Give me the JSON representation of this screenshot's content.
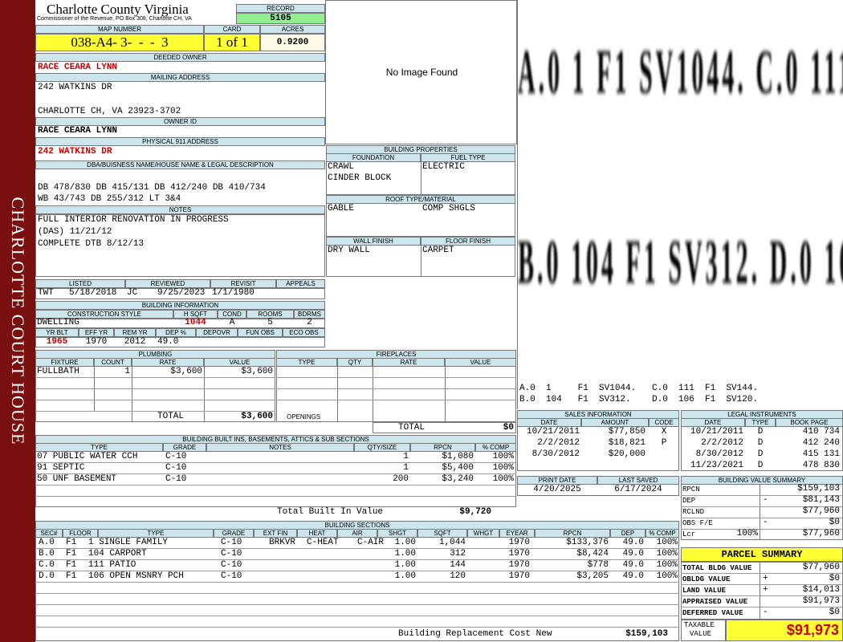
{
  "side_title": "CHARLOTTE COURT HOUSE",
  "county": {
    "title": "Charlotte County Virginia",
    "subtitle": "Commissioner of the Revenue, PO Box 308, Charlotte CH, VA"
  },
  "record": {
    "label": "RECORD",
    "value": "5105"
  },
  "map": {
    "label": "MAP NUMBER",
    "value": "038-A4- 3-  -  -  3"
  },
  "card": {
    "label": "CARD",
    "value": "1 of 1"
  },
  "acres": {
    "label": "ACRES",
    "value": "0.9200"
  },
  "deeded_owner": {
    "label": "DEEDED OWNER",
    "value": "RACE CEARA LYNN"
  },
  "mailing": {
    "label": "MAILING ADDRESS",
    "line1": "242 WATKINS DR",
    "line2": "CHARLOTTE CH, VA 23923-3702"
  },
  "owner_id": {
    "label": "OWNER ID",
    "value": "RACE CEARA LYNN"
  },
  "physical": {
    "label": "PHYSICAL 911 ADDRESS",
    "value": "242 WATKINS DR"
  },
  "legal": {
    "label": "DBA/BUISNESS NAME/HOUSE NAME & LEGAL DESCRIPTION",
    "line1": "DB 478/830 DB 415/131 DB 412/240 DB 410/734",
    "line2": "WB 43/743 DB 255/312 LT 3&4"
  },
  "notes": {
    "label": "NOTES",
    "line1": "FULL INTERIOR RENOVATION IN PROGRESS",
    "line2": "(DAS) 11/21/12",
    "line3": "COMPLETE DTB 8/12/13"
  },
  "listed": {
    "label": "LISTED",
    "by": "TWT",
    "date": "5/18/2018"
  },
  "reviewed": {
    "label": "REVIEWED",
    "by": "JC",
    "date": "9/25/2023"
  },
  "revisit": {
    "label": "REVISIT",
    "date": "1/1/1980"
  },
  "appeals": {
    "label": "APPEALS"
  },
  "building_info": {
    "label": "BUILDING INFORMATION",
    "h_style": "CONSTRUCTION STYLE",
    "h_hsqft": "H SQFT",
    "h_cond": "COND",
    "h_rooms": "ROOMS",
    "h_bdrms": "BDRMS",
    "style": "DWELLING",
    "hsqft": "1044",
    "cond": "A",
    "rooms": "5",
    "bdrms": "2",
    "h_yrblt": "YR BLT",
    "h_effyr": "EFF YR",
    "h_remyr": "REM YR",
    "h_dep": "DEP %",
    "h_depovr": "DEPOVR",
    "h_funobs": "FUN OBS",
    "h_ecoobs": "ECO OBS",
    "yrblt": "1965",
    "effyr": "1970",
    "remyr": "2012",
    "dep": "49.0"
  },
  "image_text": "No Image Found",
  "props": {
    "label": "BUILDING PROPERTIES",
    "h_foundation": "FOUNDATION",
    "h_fuel": "FUEL TYPE",
    "foundation1": "CRAWL",
    "foundation2": "CINDER BLOCK",
    "fuel": "ELECTRIC",
    "h_roof": "ROOF TYPE/MATERIAL",
    "roof_type": "GABLE",
    "roof_mat": "COMP SHGLS",
    "h_wall": "WALL FINISH",
    "h_floor": "FLOOR FINISH",
    "wall": "DRY WALL",
    "floor": "CARPET"
  },
  "sketch": {
    "row1": "A.0  1   F1  SV1044.   C.0  111  F1  SV144.",
    "row2": "B.0  104  F1  SV312.   D.0  106  F1  SV120.",
    "line1": "A.0  1     F1  SV1044.   C.0  111  F1  SV144.",
    "line2": "B.0  104   F1  SV312.    D.0  106  F1  SV120."
  },
  "plumbing": {
    "label": "PLUMBING",
    "h_fixture": "FIXTURE",
    "h_count": "COUNT",
    "h_rate": "RATE",
    "h_value": "VALUE",
    "fixture": "FULLBATH",
    "count": "1",
    "rate": "$3,600",
    "value": "$3,600",
    "total_label": "TOTAL",
    "total": "$3,600"
  },
  "fireplaces": {
    "label": "FIREPLACES",
    "h_type": "TYPE",
    "h_qty": "QTY",
    "h_rate": "RATE",
    "h_value": "VALUE",
    "openings": "OPENINGS",
    "total_label": "TOTAL",
    "total": "$0"
  },
  "builtins": {
    "label": "BUILDING BUILT INS, BASEMENTS, ATTICS & SUB SECTIONS",
    "h_type": "TYPE",
    "h_grade": "GRADE",
    "h_notes": "NOTES",
    "h_qty": "QTY/SIZE",
    "h_rpcn": "RPCN",
    "h_comp": "% COMP",
    "rows": [
      {
        "type": "07 PUBLIC WATER CCH",
        "grade": "C-10",
        "qty": "1",
        "rpcn": "$1,080",
        "comp": "100%"
      },
      {
        "type": "91 SEPTIC",
        "grade": "C-10",
        "qty": "1",
        "rpcn": "$5,400",
        "comp": "100%"
      },
      {
        "type": "50 UNF BASEMENT",
        "grade": "C-10",
        "qty": "200",
        "rpcn": "$3,240",
        "comp": "100%"
      }
    ],
    "total_label": "Total Built In Value",
    "total": "$9,720"
  },
  "sales": {
    "label": "SALES INFORMATION",
    "h_date": "DATE",
    "h_amount": "AMOUNT",
    "h_code": "CODE",
    "rows": [
      {
        "date": "10/21/2011",
        "amount": "$77,850",
        "code": "X"
      },
      {
        "date": "2/2/2012",
        "amount": "$18,821",
        "code": "P"
      },
      {
        "date": "8/30/2012",
        "amount": "$20,000",
        "code": ""
      }
    ]
  },
  "legal_inst": {
    "label": "LEGAL INSTRUMENTS",
    "h_date": "DATE",
    "h_type": "TYPE",
    "h_book": "BOOK PAGE",
    "rows": [
      {
        "date": "10/21/2011",
        "type": "D",
        "book": "410 734"
      },
      {
        "date": "2/2/2012",
        "type": "D",
        "book": "412 240"
      },
      {
        "date": "8/30/2012",
        "type": "D",
        "book": "415 131"
      },
      {
        "date": "11/23/2021",
        "type": "D",
        "book": "478 830"
      }
    ]
  },
  "print": {
    "h_print": "PRINT DATE",
    "h_saved": "LAST SAVED",
    "print_date": "4/20/2025",
    "last_saved": "6/17/2024"
  },
  "bvs": {
    "label": "BUILDING VALUE SUMMARY",
    "rpcn_l": "RPCN",
    "rpcn": "$159,103",
    "dep_l": "DEP",
    "dep_s": "-",
    "dep": "$81,143",
    "rclnd_l": "RCLND",
    "rclnd": "$77,960",
    "obs_l": "OBS F/E",
    "obs_s": "-",
    "obs": "$0",
    "lcr_l": "Lcr",
    "lcr_pct": "100%",
    "lcr": "$77,960"
  },
  "parcel": {
    "label": "PARCEL SUMMARY",
    "tbv_l": "TOTAL BLDG VALUE",
    "tbv": "$77,960",
    "obv_l": "OBLDG VALUE",
    "obv_s": "+",
    "obv": "$0",
    "land_l": "LAND VALUE",
    "land_s": "+",
    "land": "$14,013",
    "app_l": "APPRAISED VALUE",
    "app": "$91,973",
    "def_l": "DEFERRED VALUE",
    "def_s": "-",
    "def": "$0",
    "tax_l1": "TAXABLE",
    "tax_l2": "VALUE",
    "tax": "$91,973"
  },
  "sections": {
    "label": "BUILDING SECTIONS",
    "h_sec": "SEC#",
    "h_floor": "FLOOR",
    "h_type": "TYPE",
    "h_grade": "GRADE",
    "h_extfin": "EXT FIN",
    "h_heat": "HEAT",
    "h_air": "AIR",
    "h_shgt": "SHGT",
    "h_sqft": "SQFT",
    "h_whgt": "WHGT",
    "h_eyear": "EYEAR",
    "h_rpcn": "RPCN",
    "h_dep": "DEP",
    "h_comp": "% COMP",
    "rows": [
      {
        "sec": "A.0",
        "floor": "F1",
        "type": "1 SINGLE FAMILY",
        "grade": "C-10",
        "extfin": "BRKVR",
        "heat": "C-HEAT",
        "air": "C-AIR",
        "shgt": "1.00",
        "sqft": "1,044",
        "eyear": "1970",
        "rpcn": "$133,376",
        "dep": "49.0",
        "comp": "100%"
      },
      {
        "sec": "B.0",
        "floor": "F1",
        "type": "104 CARPORT",
        "grade": "C-10",
        "extfin": "",
        "heat": "",
        "air": "",
        "shgt": "1.00",
        "sqft": "312",
        "eyear": "1970",
        "rpcn": "$8,424",
        "dep": "49.0",
        "comp": "100%"
      },
      {
        "sec": "C.0",
        "floor": "F1",
        "type": "111 PATIO",
        "grade": "C-10",
        "extfin": "",
        "heat": "",
        "air": "",
        "shgt": "1.00",
        "sqft": "144",
        "eyear": "1970",
        "rpcn": "$778",
        "dep": "49.0",
        "comp": "100%"
      },
      {
        "sec": "D.0",
        "floor": "F1",
        "type": "106 OPEN MSNRY PCH",
        "grade": "C-10",
        "extfin": "",
        "heat": "",
        "air": "",
        "shgt": "1.00",
        "sqft": "120",
        "eyear": "1970",
        "rpcn": "$3,205",
        "dep": "49.0",
        "comp": "100%"
      }
    ],
    "brcn_label": "Building Replacement Cost New",
    "brcn": "$159,103"
  }
}
